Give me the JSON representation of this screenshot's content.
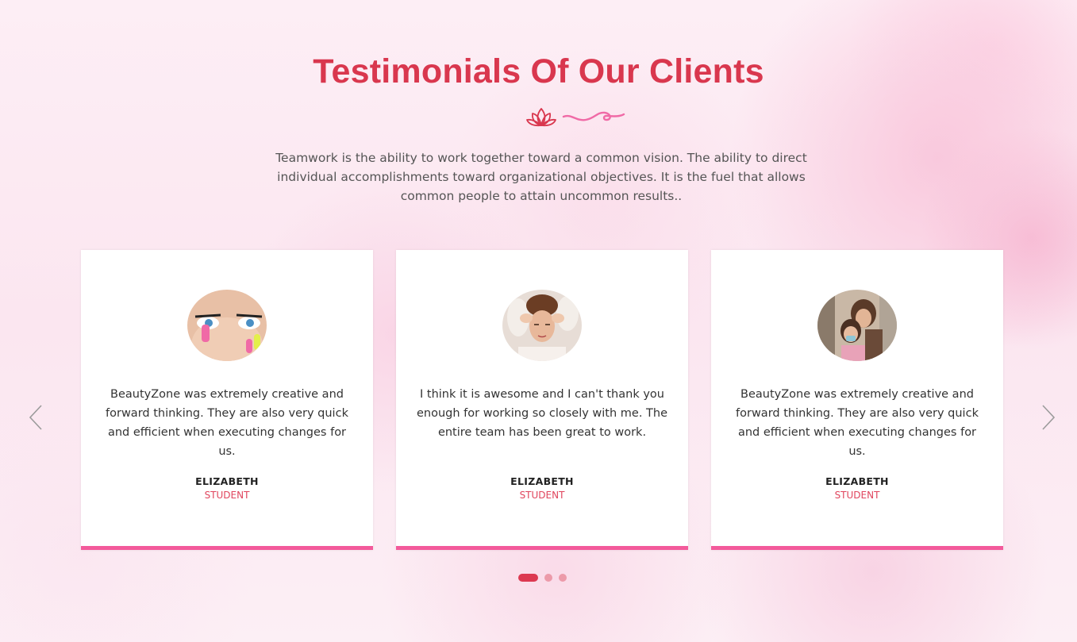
{
  "section": {
    "title": "Testimonials Of Our Clients",
    "intro": "Teamwork is the ability to work together toward a common vision. The ability to direct individual accomplishments toward organizational objectives. It is the fuel that allows common people to attain uncommon results.."
  },
  "icons": {
    "divider": "lotus-icon",
    "prev": "chevron-left-icon",
    "next": "chevron-right-icon"
  },
  "testimonials": [
    {
      "quote": "BeautyZone was extremely creative and forward thinking. They are also very quick and efficient when executing changes for us.",
      "name": "ELIZABETH",
      "role": "STUDENT"
    },
    {
      "quote": "I think it is awesome and I can't thank you enough for working so closely with me. The entire team has been great to work.",
      "name": "ELIZABETH",
      "role": "STUDENT"
    },
    {
      "quote": "BeautyZone was extremely creative and forward thinking. They are also very quick and efficient when executing changes for us.",
      "name": "ELIZABETH",
      "role": "STUDENT"
    }
  ],
  "pagination": {
    "active_index": 1,
    "total": 3
  },
  "colors": {
    "title": "#d9374e",
    "accent_border": "#f35a9b",
    "role": "#e0455d",
    "dot_active": "#dc3951",
    "dot_inactive": "#ec9aa9"
  }
}
